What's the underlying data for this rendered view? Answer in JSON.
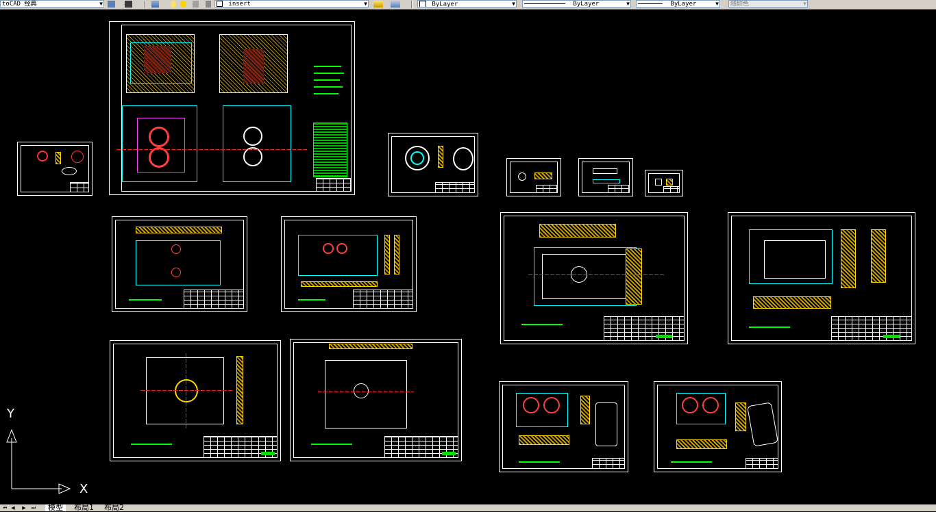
{
  "toolbar": {
    "workspace": "toCAD 经典",
    "layer": "insert",
    "color": "ByLayer",
    "linetype": "ByLayer",
    "lineweight": "ByLayer",
    "plotstyle": "随颜色"
  },
  "ucs": {
    "x_label": "X",
    "y_label": "Y"
  },
  "tabs": {
    "model": "模型",
    "layout1": "布局1",
    "layout2": "布局2"
  }
}
